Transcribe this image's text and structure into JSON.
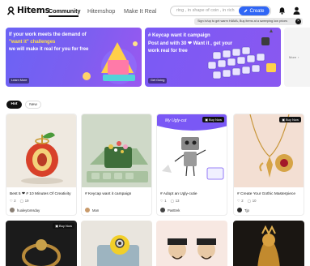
{
  "header": {
    "logo_text": "Hitems",
    "nav": [
      "Community",
      "Hitemshop",
      "Make It Real"
    ],
    "search_placeholder": "ring , in shape of coin , in rich",
    "create_label": "Create",
    "tooltip": "Sign in/up to get warm HAMA, Buy items at a sweeping low prices"
  },
  "banners": [
    {
      "line1": "If your work meets the demand of",
      "line2": "\"want it\" challenges",
      "line3": "we will make it real for you for free",
      "button": "Learn More"
    },
    {
      "line1": "# Keycap want it campaign",
      "line2": "Post and with 30 ❤ Want it , get your",
      "line3": "work real for free",
      "button": "Get Going"
    }
  ],
  "more_label": "More",
  "tabs": {
    "hot": "Hot",
    "new": "New"
  },
  "cards": [
    {
      "title": "Best 5 ❤ # 10 Minutes Of Creativity",
      "likes": "2",
      "comments": "19",
      "user": "hualeytomsday"
    },
    {
      "title": "# Keycap want it campaign",
      "likes": "",
      "comments": "",
      "user": "Man"
    },
    {
      "title": "# Adopt an Ugly-cutie",
      "likes": "1",
      "comments": "13",
      "user": "Pasttrek",
      "buy": "Buy Now",
      "bubble": "My Ugly-cut"
    },
    {
      "title": "# Create Your Gothic Masterpiece",
      "likes": "2",
      "comments": "10",
      "user": "Tjp",
      "buy": "Buy Now"
    }
  ],
  "row2": [
    {
      "buy": "Buy Now"
    },
    {},
    {},
    {}
  ],
  "colors": {
    "accent": "#2f66f6",
    "banner_purple": "#7a5af5"
  }
}
